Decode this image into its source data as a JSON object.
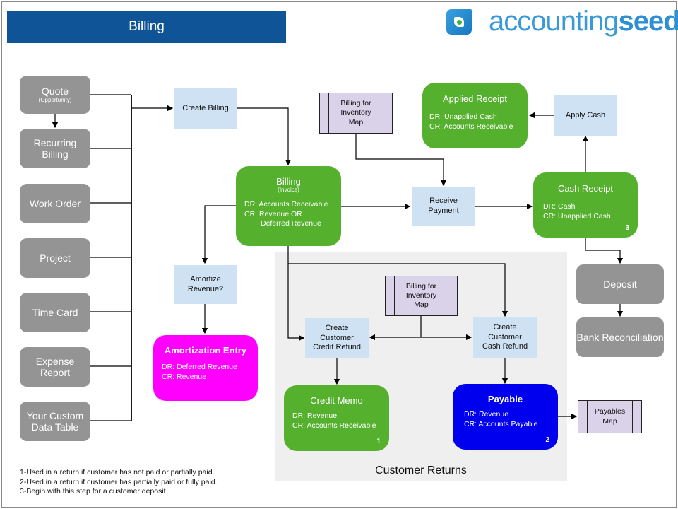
{
  "header": {
    "title": "Billing"
  },
  "logo": {
    "light": "accounting",
    "bold": "seed",
    "icon": "accountingseed-logo-icon"
  },
  "sources": [
    {
      "label": "Quote",
      "sub": "(Opportunity)"
    },
    {
      "label": "Recurring Billing",
      "sub": ""
    },
    {
      "label": "Work Order",
      "sub": ""
    },
    {
      "label": "Project",
      "sub": ""
    },
    {
      "label": "Time Card",
      "sub": ""
    },
    {
      "label": "Expense Report",
      "sub": ""
    },
    {
      "label": "Your Custom Data Table",
      "sub": ""
    }
  ],
  "steps": {
    "create_billing": "Create Billing",
    "amortize_revenue": "Amortize Revenue?",
    "receive_payment": "Receive Payment",
    "apply_cash": "Apply Cash",
    "create_credit_refund": "Create Customer Credit Refund",
    "create_cash_refund": "Create Customer Cash Refund"
  },
  "maps": {
    "billing_inventory_top": "Billing for Inventory Map",
    "billing_inventory_returns": "Billing for Inventory Map",
    "payables": "Payables Map"
  },
  "records": {
    "billing": {
      "title": "Billing",
      "sub": "(Invoice)",
      "dr": "DR:  Accounts Receivable",
      "cr": "CR:  Revenue OR",
      "cr2": "Deferred Revenue"
    },
    "applied_receipt": {
      "title": "Applied Receipt",
      "dr": "DR:  Unapplied Cash",
      "cr": "CR:  Accounts Receivable"
    },
    "cash_receipt": {
      "title": "Cash Receipt",
      "dr": "DR:  Cash",
      "cr": "CR:  Unapplied Cash",
      "num": "3"
    },
    "amortization_entry": {
      "title": "Amortization Entry",
      "dr": "DR:  Deferred Revenue",
      "cr": "CR:  Revenue"
    },
    "credit_memo": {
      "title": "Credit Memo",
      "dr": "DR:  Revenue",
      "cr": "CR:  Accounts Receivable",
      "num": "1"
    },
    "payable": {
      "title": "Payable",
      "dr": "DR:  Revenue",
      "cr": "CR:  Accounts Payable",
      "num": "2"
    }
  },
  "banking": {
    "deposit": "Deposit",
    "bank_rec": "Bank Reconciliation"
  },
  "returns_label": "Customer Returns",
  "footnotes": [
    "1-Used in a return if customer has not paid or partially paid.",
    "2-Used in a return if customer has partially paid or fully paid.",
    "3-Begin with this step for a customer deposit."
  ],
  "colors": {
    "header": "#0f5496",
    "record_green": "#55b02e",
    "amortization": "#ff00ff",
    "payable": "#0000ee",
    "action_blue": "#cfe2f3",
    "map_purple": "#d9d2e9",
    "source_gray": "#949494"
  }
}
